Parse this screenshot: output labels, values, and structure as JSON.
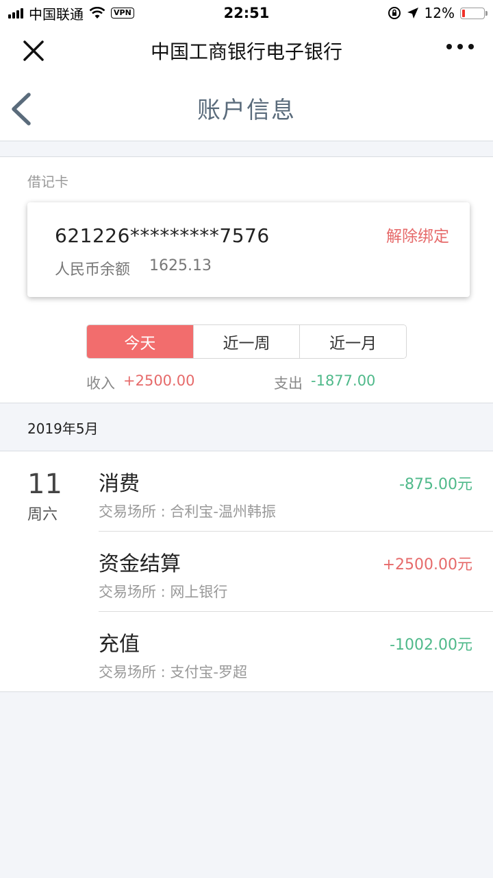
{
  "status_bar": {
    "carrier": "中国联通",
    "vpn": "VPN",
    "time": "22:51",
    "battery": "12%"
  },
  "title_bar": {
    "title": "中国工商银行电子银行"
  },
  "page_header": {
    "title": "账户信息"
  },
  "account": {
    "card_type": "借记卡",
    "card_number": "621226*********7576",
    "unbind_label": "解除绑定",
    "balance_label": "人民币余额",
    "balance_value": "1625.13"
  },
  "period_tabs": [
    {
      "label": "今天",
      "active": true
    },
    {
      "label": "近一周",
      "active": false
    },
    {
      "label": "近一月",
      "active": false
    }
  ],
  "summary": {
    "income_label": "收入",
    "income_value": "+2500.00",
    "expense_label": "支出",
    "expense_value": "-1877.00"
  },
  "month": "2019年5月",
  "day": {
    "date": "11",
    "weekday": "周六"
  },
  "transactions": [
    {
      "title": "消费",
      "place": "交易场所 : 合利宝-温州韩振",
      "amount": "-875.00元"
    },
    {
      "title": "资金结算",
      "place": "交易场所 : 网上银行",
      "amount": "+2500.00元"
    },
    {
      "title": "充值",
      "place": "交易场所 : 支付宝-罗超",
      "amount": "-1002.00元"
    }
  ],
  "colors": {
    "accent": "#f26d6d",
    "positive": "#e66a6a",
    "negative": "#4fb98a"
  }
}
